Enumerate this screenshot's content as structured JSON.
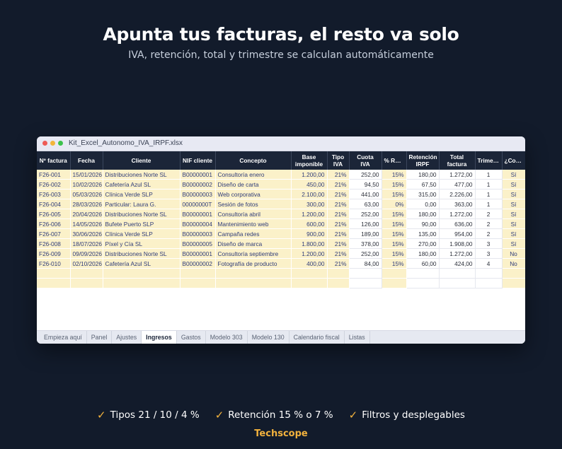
{
  "headline": "Apunta tus facturas, el resto va solo",
  "subhead": "IVA, retención, total y trimestre se calculan automáticamente",
  "window": {
    "filename": "Kit_Excel_Autonomo_IVA_IRPF.xlsx"
  },
  "table": {
    "headers": [
      "Nº factura",
      "Fecha",
      "Cliente",
      "NIF cliente",
      "Concepto",
      "Base imponible",
      "Tipo IVA",
      "Cuota IVA",
      "% Rete…",
      "Retención IRPF",
      "Total factura",
      "Trimes…",
      "¿Cob…"
    ],
    "rows": [
      [
        "F26-001",
        "15/01/2026",
        "Distribuciones Norte SL",
        "B00000001",
        "Consultoría enero",
        "1.200,00",
        "21%",
        "252,00",
        "15%",
        "180,00",
        "1.272,00",
        "1",
        "Sí"
      ],
      [
        "F26-002",
        "10/02/2026",
        "Cafetería Azul SL",
        "B00000002",
        "Diseño de carta",
        "450,00",
        "21%",
        "94,50",
        "15%",
        "67,50",
        "477,00",
        "1",
        "Sí"
      ],
      [
        "F26-003",
        "05/03/2026",
        "Clínica Verde SLP",
        "B00000003",
        "Web corporativa",
        "2.100,00",
        "21%",
        "441,00",
        "15%",
        "315,00",
        "2.226,00",
        "1",
        "Sí"
      ],
      [
        "F26-004",
        "28/03/2026",
        "Particular: Laura G.",
        "00000000T",
        "Sesión de fotos",
        "300,00",
        "21%",
        "63,00",
        "0%",
        "0,00",
        "363,00",
        "1",
        "Sí"
      ],
      [
        "F26-005",
        "20/04/2026",
        "Distribuciones Norte SL",
        "B00000001",
        "Consultoría abril",
        "1.200,00",
        "21%",
        "252,00",
        "15%",
        "180,00",
        "1.272,00",
        "2",
        "Sí"
      ],
      [
        "F26-006",
        "14/05/2026",
        "Bufete Puerto SLP",
        "B00000004",
        "Mantenimiento web",
        "600,00",
        "21%",
        "126,00",
        "15%",
        "90,00",
        "636,00",
        "2",
        "Sí"
      ],
      [
        "F26-007",
        "30/06/2026",
        "Clínica Verde SLP",
        "B00000003",
        "Campaña redes",
        "900,00",
        "21%",
        "189,00",
        "15%",
        "135,00",
        "954,00",
        "2",
        "Sí"
      ],
      [
        "F26-008",
        "18/07/2026",
        "Píxel y Cía SL",
        "B00000005",
        "Diseño de marca",
        "1.800,00",
        "21%",
        "378,00",
        "15%",
        "270,00",
        "1.908,00",
        "3",
        "Sí"
      ],
      [
        "F26-009",
        "09/09/2026",
        "Distribuciones Norte SL",
        "B00000001",
        "Consultoría septiembre",
        "1.200,00",
        "21%",
        "252,00",
        "15%",
        "180,00",
        "1.272,00",
        "3",
        "No"
      ],
      [
        "F26-010",
        "02/10/2026",
        "Cafetería Azul SL",
        "B00000002",
        "Fotografía de producto",
        "400,00",
        "21%",
        "84,00",
        "15%",
        "60,00",
        "424,00",
        "4",
        "No"
      ],
      [
        "",
        "",
        "",
        "",
        "",
        "",
        "",
        "",
        "",
        "",
        "",
        "",
        ""
      ],
      [
        "",
        "",
        "",
        "",
        "",
        "",
        "",
        "",
        "",
        "",
        "",
        "",
        ""
      ]
    ]
  },
  "tabs": [
    "Empieza aquí",
    "Panel",
    "Ajustes",
    "Ingresos",
    "Gastos",
    "Modelo 303",
    "Modelo 130",
    "Calendario fiscal",
    "Listas"
  ],
  "active_tab": "Ingresos",
  "features": [
    "Tipos 21 / 10 / 4 %",
    "Retención 15 % o 7 %",
    "Filtros y desplegables"
  ],
  "brand": "Techscope",
  "colors": {
    "background": "#121b2b",
    "accent": "#f2b23d",
    "header": "#1b2538",
    "input_cell": "#fbf1c9"
  }
}
